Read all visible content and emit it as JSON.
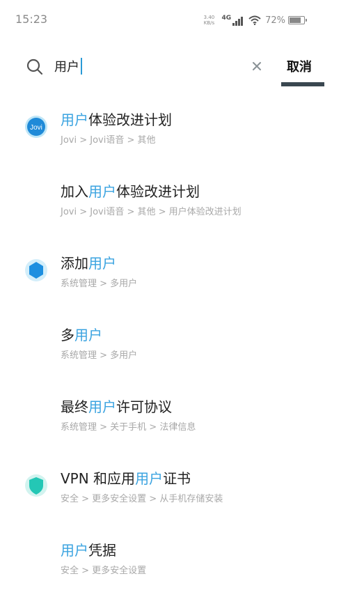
{
  "status_bar": {
    "time": "15:23",
    "net_speed_value": "3.40",
    "net_speed_unit": "KB/s",
    "network_type": "4G",
    "battery_percent": "72%",
    "battery_level": 0.72
  },
  "search": {
    "query": "用户",
    "cancel_label": "取消",
    "accent_color": "#3aa3e0"
  },
  "results": [
    {
      "icon": "jovi-logo-icon",
      "title_pre": "",
      "title_hl": "用户",
      "title_post": "体验改进计划",
      "path": "Jovi > Jovi语音 > 其他"
    },
    {
      "icon": "",
      "title_pre": "加入",
      "title_hl": "用户",
      "title_post": "体验改进计划",
      "path": "Jovi > Jovi语音 > 其他 > 用户体验改进计划"
    },
    {
      "icon": "hexagon-icon",
      "title_pre": "添加",
      "title_hl": "用户",
      "title_post": "",
      "path": "系统管理 > 多用户"
    },
    {
      "icon": "",
      "title_pre": "多",
      "title_hl": "用户",
      "title_post": "",
      "path": "系统管理 > 多用户"
    },
    {
      "icon": "",
      "title_pre": "最终",
      "title_hl": "用户",
      "title_post": "许可协议",
      "path": "系统管理 > 关于手机 > 法律信息"
    },
    {
      "icon": "shield-icon",
      "title_pre": "VPN 和应用",
      "title_hl": "用户",
      "title_post": "证书",
      "path": "安全 > 更多安全设置 > 从手机存储安装"
    },
    {
      "icon": "",
      "title_pre": "",
      "title_hl": "用户",
      "title_post": "凭据",
      "path": "安全 > 更多安全设置"
    }
  ]
}
